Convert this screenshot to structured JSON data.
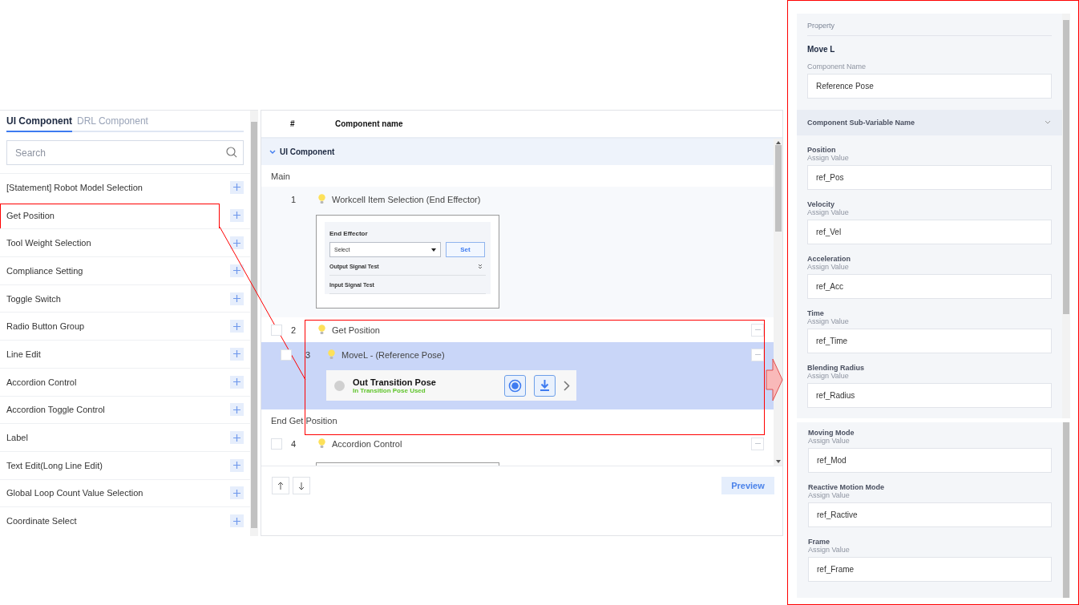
{
  "library": {
    "tabs": [
      {
        "label": "UI Component",
        "selected": true
      },
      {
        "label": "DRL Component",
        "selected": false
      }
    ],
    "search": {
      "placeholder": "Search"
    },
    "items": [
      {
        "label": "[Statement] Robot Model Selection",
        "highlighted": false
      },
      {
        "label": "Get Position",
        "highlighted": true
      },
      {
        "label": "Tool Weight Selection",
        "highlighted": false
      },
      {
        "label": "Compliance Setting",
        "highlighted": false
      },
      {
        "label": "Toggle Switch",
        "highlighted": false
      },
      {
        "label": "Radio Button Group",
        "highlighted": false
      },
      {
        "label": "Line Edit",
        "highlighted": false
      },
      {
        "label": "Accordion Control",
        "highlighted": false
      },
      {
        "label": "Accordion Toggle Control",
        "highlighted": false
      },
      {
        "label": "Label",
        "highlighted": false
      },
      {
        "label": "Text Edit(Long Line Edit)",
        "highlighted": false
      },
      {
        "label": "Global Loop Count Value Selection",
        "highlighted": false
      },
      {
        "label": "Coordinate Select",
        "highlighted": false
      }
    ]
  },
  "composition": {
    "columns": [
      "#",
      "Component name"
    ],
    "group": {
      "label": "UI Component",
      "expanded": true
    },
    "rows": [
      {
        "kind": "section",
        "label": "Main"
      },
      {
        "kind": "item",
        "number": "1",
        "name": "Workcell Item Selection (End Effector)",
        "selected": false,
        "preview": {
          "kind": "end_effector",
          "title": "End Effector",
          "select": "Select",
          "button": "Set",
          "rows": [
            "Output Signal Test",
            "Input Signal Test"
          ]
        }
      },
      {
        "kind": "item",
        "number": "2",
        "name": "Get Position",
        "selected": false,
        "checked": false,
        "children": [
          {
            "kind": "item",
            "number": "3",
            "name": "MoveL - (Reference Pose)",
            "selected": true,
            "checked": false,
            "preview": {
              "kind": "pose",
              "title": "Out Transition Pose",
              "subtitle": "In Transition Pose Used"
            }
          }
        ]
      },
      {
        "kind": "section",
        "label": "End Get Position"
      },
      {
        "kind": "item",
        "number": "4",
        "name": "Accordion Control",
        "selected": false,
        "checked": false,
        "preview": {
          "kind": "cut"
        }
      }
    ],
    "preview_button": "Preview"
  },
  "property": {
    "heading": "Property",
    "title": "Move L",
    "name_label": "Component Name",
    "name_value": "Reference Pose",
    "section": {
      "label": "Component Sub-Variable Name",
      "expanded": true
    },
    "fields": [
      {
        "label": "Position",
        "sublabel": "Assign Value",
        "value": "ref_Pos"
      },
      {
        "label": "Velocity",
        "sublabel": "Assign Value",
        "value": "ref_Vel"
      },
      {
        "label": "Acceleration",
        "sublabel": "Assign Value",
        "value": "ref_Acc"
      },
      {
        "label": "Time",
        "sublabel": "Assign Value",
        "value": "ref_Time"
      },
      {
        "label": "Blending Radius",
        "sublabel": "Assign Value",
        "value": "ref_Radius"
      }
    ],
    "continued_fields": [
      {
        "label": "Moving Mode",
        "sublabel": "Assign Value",
        "value": "ref_Mod"
      },
      {
        "label": "Reactive Motion Mode",
        "sublabel": "Assign Value",
        "value": "ref_Ractive"
      },
      {
        "label": "Frame",
        "sublabel": "Assign Value",
        "value": "ref_Frame"
      }
    ]
  }
}
